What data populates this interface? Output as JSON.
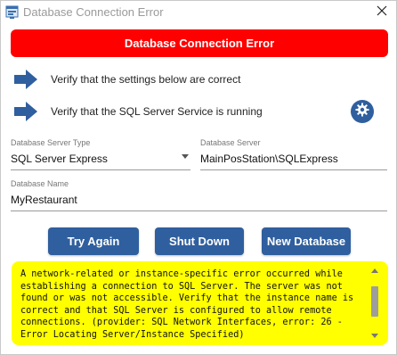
{
  "window": {
    "title": "Database Connection Error"
  },
  "banner": {
    "text": "Database Connection Error",
    "color": "#ff0000"
  },
  "steps": [
    {
      "icon": "arrow-right-icon",
      "text": "Verify that the settings below are correct"
    },
    {
      "icon": "arrow-right-icon",
      "text": "Verify that the SQL Server Service is running"
    }
  ],
  "settings_icon": "gear-icon",
  "fields": {
    "server_type": {
      "label": "Database Server Type",
      "value": "SQL Server Express"
    },
    "server": {
      "label": "Database Server",
      "value": "MainPosStation\\SQLExpress"
    },
    "name": {
      "label": "Database Name",
      "value": "MyRestaurant"
    }
  },
  "buttons": {
    "try_again": "Try Again",
    "shut_down": "Shut Down",
    "new_database": "New Database"
  },
  "error_message": "A network-related or instance-specific error occurred while establishing a connection to SQL Server. The server was not found or was not accessible. Verify that the instance name is correct and that SQL Server is configured to allow remote connections. (provider: SQL Network Interfaces, error: 26 - Error Locating Server/Instance Specified)",
  "colors": {
    "accent": "#2f5f9e",
    "error_bg": "#ffff00",
    "banner": "#ff0000"
  }
}
